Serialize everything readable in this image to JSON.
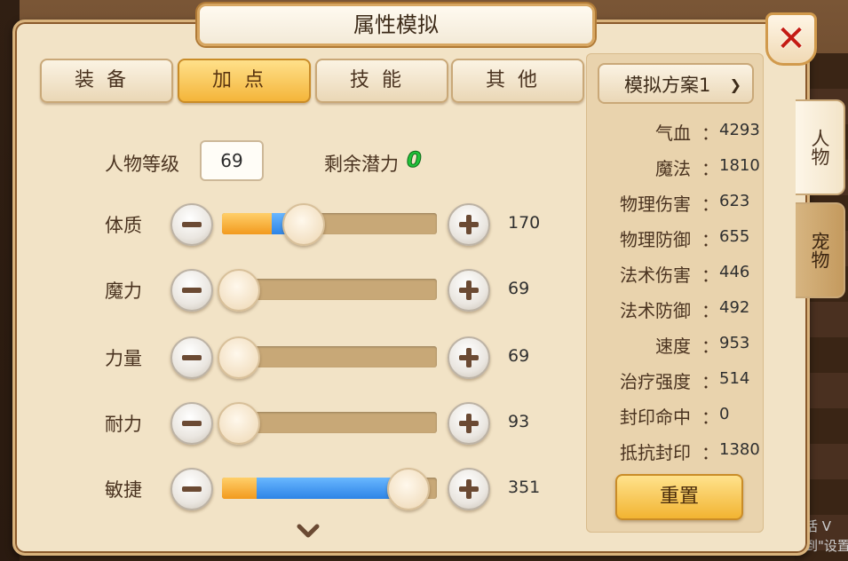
{
  "window": {
    "title": "属性模拟"
  },
  "tabs": [
    {
      "label": "装备",
      "active": false
    },
    {
      "label": "加点",
      "active": true
    },
    {
      "label": "技能",
      "active": false
    },
    {
      "label": "其他",
      "active": false
    }
  ],
  "side_tabs": [
    {
      "label": "人物",
      "active": true
    },
    {
      "label": "宠物",
      "active": false
    }
  ],
  "character": {
    "level_label": "人物等级",
    "level_value": "69",
    "potential_label": "剩余潜力",
    "potential_value": "0"
  },
  "stats": [
    {
      "label": "体质",
      "value": "170",
      "base_fill": 0.23,
      "total_fill": 0.37
    },
    {
      "label": "魔力",
      "value": "69",
      "base_fill": 0.07,
      "total_fill": 0.07
    },
    {
      "label": "力量",
      "value": "69",
      "base_fill": 0.07,
      "total_fill": 0.07
    },
    {
      "label": "耐力",
      "value": "93",
      "base_fill": 0.07,
      "total_fill": 0.07
    },
    {
      "label": "敏捷",
      "value": "351",
      "base_fill": 0.16,
      "total_fill": 0.86
    }
  ],
  "plan": {
    "selected": "模拟方案1"
  },
  "attributes": [
    {
      "label": "气血",
      "value": "4293"
    },
    {
      "label": "魔法",
      "value": "1810"
    },
    {
      "label": "物理伤害",
      "value": "623"
    },
    {
      "label": "物理防御",
      "value": "655"
    },
    {
      "label": "法术伤害",
      "value": "446"
    },
    {
      "label": "法术防御",
      "value": "492"
    },
    {
      "label": "速度",
      "value": "953"
    },
    {
      "label": "治疗强度",
      "value": "514"
    },
    {
      "label": "封印命中",
      "value": "0"
    },
    {
      "label": "抵抗封印",
      "value": "1380"
    }
  ],
  "attr_colon": "：",
  "reset_label": "重置",
  "watermark": {
    "line1": "激活 V",
    "line2": "转到\"设置"
  },
  "colors": {
    "accent_orange": "#f29a1e",
    "accent_blue": "#2d84e6",
    "close_red": "#c41b13",
    "potential_green": "#22c23a"
  },
  "icons": {
    "close": "close-icon",
    "minus": "minus-icon",
    "plus": "plus-icon",
    "dropdown": "chevron-down-icon",
    "more": "chevron-down-icon"
  }
}
